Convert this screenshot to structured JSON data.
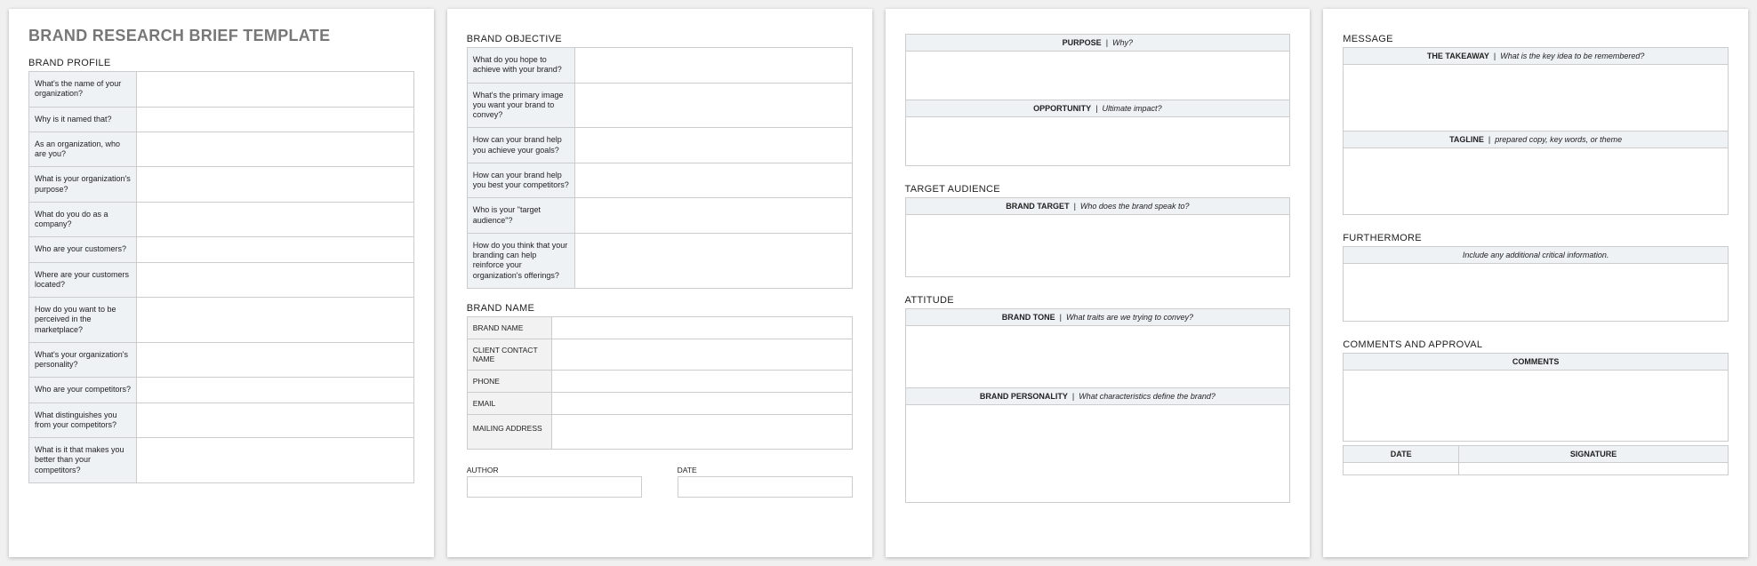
{
  "title": "BRAND RESEARCH BRIEF TEMPLATE",
  "page1": {
    "section": "BRAND PROFILE",
    "rows": [
      "What's the name of your organization?",
      "Why is it named that?",
      "As an organization, who are you?",
      "What is your organization's purpose?",
      "What do you do as a company?",
      "Who are your customers?",
      "Where are your customers located?",
      "How do you want to be perceived in the marketplace?",
      "What's your organization's personality?",
      "Who are your competitors?",
      "What distinguishes you from your competitors?",
      "What is it that makes you better than your competitors?"
    ]
  },
  "page2": {
    "objective_section": "BRAND OBJECTIVE",
    "objective_rows": [
      "What do you hope to achieve with your brand?",
      "What's the primary image you want your brand to convey?",
      "How can your brand help you achieve your goals?",
      "How can your brand help you best your competitors?",
      "Who is your \"target audience\"?",
      "How do you think that your branding can help reinforce your organization's offerings?"
    ],
    "name_section": "BRAND NAME",
    "name_rows": [
      "BRAND NAME",
      "CLIENT CONTACT NAME",
      "PHONE",
      "EMAIL",
      "MAILING ADDRESS"
    ],
    "author": "AUTHOR",
    "date": "DATE"
  },
  "page3": {
    "purpose_label": "PURPOSE",
    "purpose_prompt": "Why?",
    "opportunity_label": "OPPORTUNITY",
    "opportunity_prompt": "Ultimate impact?",
    "target_section": "TARGET AUDIENCE",
    "target_label": "BRAND TARGET",
    "target_prompt": "Who does the brand speak to?",
    "attitude_section": "ATTITUDE",
    "tone_label": "BRAND TONE",
    "tone_prompt": "What traits are we trying to convey?",
    "personality_label": "BRAND PERSONALITY",
    "personality_prompt": "What characteristics define the brand?"
  },
  "page4": {
    "message_section": "MESSAGE",
    "takeaway_label": "THE TAKEAWAY",
    "takeaway_prompt": "What is the key idea to be remembered?",
    "tagline_label": "TAGLINE",
    "tagline_prompt": "prepared copy, key words, or theme",
    "furthermore_section": "FURTHERMORE",
    "furthermore_prompt": "Include any additional critical information.",
    "comments_section": "COMMENTS AND APPROVAL",
    "comments_label": "COMMENTS",
    "date_label": "DATE",
    "signature_label": "SIGNATURE"
  }
}
